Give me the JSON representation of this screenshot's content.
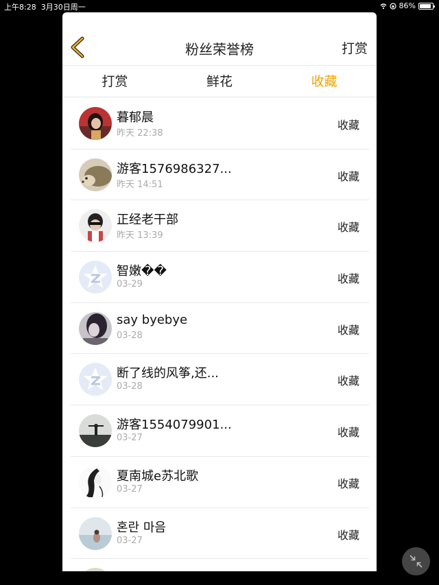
{
  "status": {
    "time": "上午8:28",
    "date": "3月30日周一",
    "battery": "86%",
    "battery_level": 0.86
  },
  "nav": {
    "title": "粉丝荣誉榜",
    "right_label": "打赏"
  },
  "tabs": [
    {
      "label": "打赏",
      "active": false
    },
    {
      "label": "鲜花",
      "active": false
    },
    {
      "label": "收藏",
      "active": true
    }
  ],
  "colors": {
    "accent": "#f0a400",
    "back_icon": "#e8b020"
  },
  "rows": [
    {
      "name": "暮郁晨",
      "time": "昨天 22:38",
      "action": "收藏",
      "avatar": "photo-portrait"
    },
    {
      "name": "游客1576986327...",
      "time": "昨天 14:51",
      "action": "收藏",
      "avatar": "photo-hedgehog"
    },
    {
      "name": "正经老干部",
      "time": "昨天 13:39",
      "action": "收藏",
      "avatar": "photo-person"
    },
    {
      "name": "智嫩��",
      "time": "03-29",
      "action": "收藏",
      "avatar": "default-star"
    },
    {
      "name": "say byebye",
      "time": "03-28",
      "action": "收藏",
      "avatar": "photo-dark-portrait"
    },
    {
      "name": "断了线的风筝,还...",
      "time": "03-28",
      "action": "收藏",
      "avatar": "default-star"
    },
    {
      "name": "游客1554079901...",
      "time": "03-27",
      "action": "收藏",
      "avatar": "photo-silhouette"
    },
    {
      "name": "夏南城e苏北歌",
      "time": "03-27",
      "action": "收藏",
      "avatar": "photo-sketch"
    },
    {
      "name": "혼란 마음",
      "time": "03-27",
      "action": "收藏",
      "avatar": "photo-seaside"
    }
  ]
}
